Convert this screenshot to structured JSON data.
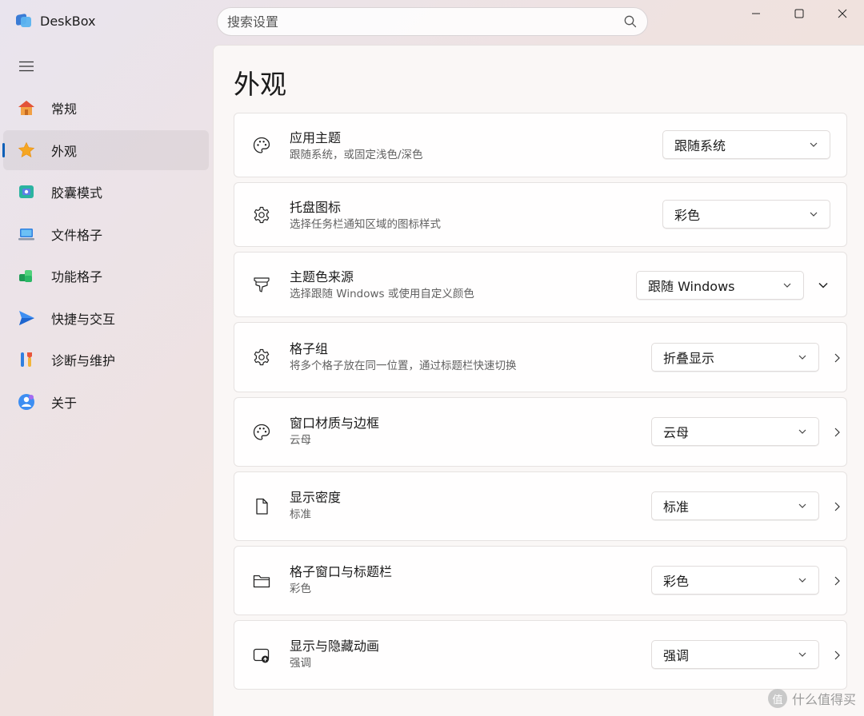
{
  "app": {
    "title": "DeskBox"
  },
  "search": {
    "placeholder": "搜索设置"
  },
  "nav": [
    {
      "label": "常规",
      "icon": "home-icon"
    },
    {
      "label": "外观",
      "icon": "star-icon",
      "active": true
    },
    {
      "label": "胶囊模式",
      "icon": "capsule-icon"
    },
    {
      "label": "文件格子",
      "icon": "laptop-icon"
    },
    {
      "label": "功能格子",
      "icon": "blocks-icon"
    },
    {
      "label": "快捷与交互",
      "icon": "send-icon"
    },
    {
      "label": "诊断与维护",
      "icon": "tools-icon"
    },
    {
      "label": "关于",
      "icon": "about-icon"
    }
  ],
  "page": {
    "title": "外观"
  },
  "settings": [
    {
      "title": "应用主题",
      "subtitle": "跟随系统，或固定浅色/深色",
      "value": "跟随系统",
      "icon": "palette-icon"
    },
    {
      "title": "托盘图标",
      "subtitle": "选择任务栏通知区域的图标样式",
      "value": "彩色",
      "icon": "gear-icon"
    },
    {
      "title": "主题色来源",
      "subtitle": "选择跟随 Windows 或使用自定义颜色",
      "value": "跟随 Windows",
      "icon": "brush-icon"
    },
    {
      "title": "格子组",
      "subtitle": "将多个格子放在同一位置，通过标题栏快速切换",
      "value": "折叠显示",
      "icon": "gear-icon"
    },
    {
      "title": "窗口材质与边框",
      "subtitle": "云母",
      "value": "云母",
      "icon": "palette-icon"
    },
    {
      "title": "显示密度",
      "subtitle": "标准",
      "value": "标准",
      "icon": "document-icon"
    },
    {
      "title": "格子窗口与标题栏",
      "subtitle": "彩色",
      "value": "彩色",
      "icon": "folder-icon"
    },
    {
      "title": "显示与隐藏动画",
      "subtitle": "强调",
      "value": "强调",
      "icon": "animation-icon"
    }
  ],
  "watermark": {
    "glyph": "值",
    "text": "什么值得买"
  },
  "colors": {
    "accent": "#0a5fb8"
  }
}
